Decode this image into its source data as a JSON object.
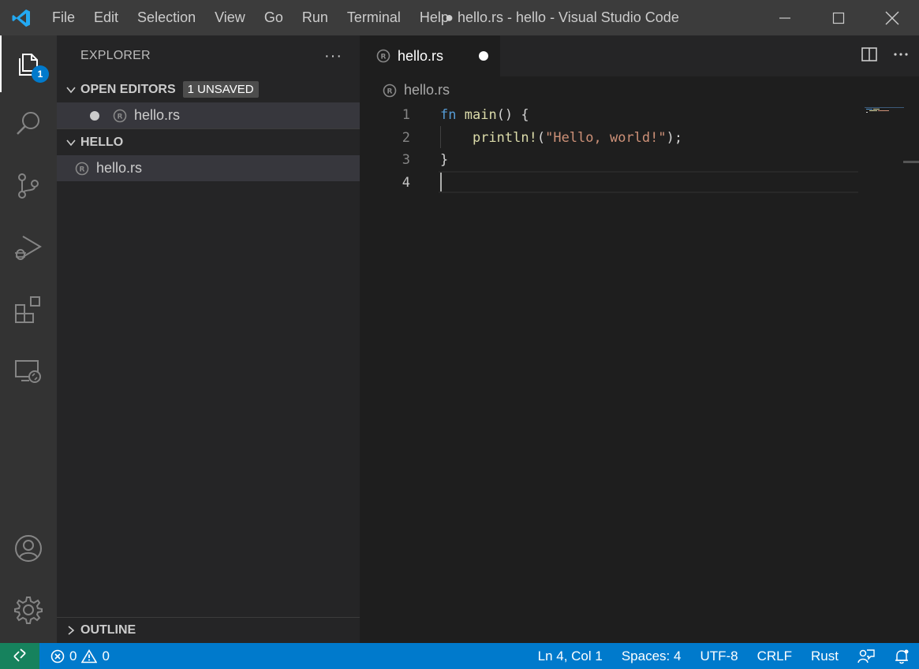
{
  "titlebar": {
    "menu": [
      "File",
      "Edit",
      "Selection",
      "View",
      "Go",
      "Run",
      "Terminal",
      "Help"
    ],
    "window_title": "● hello.rs - hello - Visual Studio Code"
  },
  "activitybar": {
    "explorer_badge": "1"
  },
  "sidebar": {
    "title": "EXPLORER",
    "more": "···",
    "open_editors": {
      "label": "OPEN EDITORS",
      "badge": "1 UNSAVED",
      "files": [
        "hello.rs"
      ]
    },
    "folder": {
      "label": "HELLO",
      "files": [
        "hello.rs"
      ]
    },
    "outline_label": "OUTLINE"
  },
  "editor": {
    "tab_label": "hello.rs",
    "breadcrumb": "hello.rs",
    "line_numbers": [
      "1",
      "2",
      "3",
      "4"
    ],
    "code": {
      "l1_kw": "fn",
      "l1_fn": "main",
      "l1_rest": "() {",
      "l2_indent": "    ",
      "l2_macro": "println!",
      "l2_open": "(",
      "l2_str": "\"Hello, world!\"",
      "l2_close": ");",
      "l3": "}",
      "l4": ""
    }
  },
  "statusbar": {
    "errors": "0",
    "warnings": "0",
    "position": "Ln 4, Col 1",
    "spaces": "Spaces: 4",
    "encoding": "UTF-8",
    "eol": "CRLF",
    "language": "Rust"
  },
  "colors": {
    "accent": "#007acc",
    "remote": "#16825d",
    "keyword": "#569cd6",
    "function": "#dcdcaa",
    "string": "#ce9178"
  }
}
